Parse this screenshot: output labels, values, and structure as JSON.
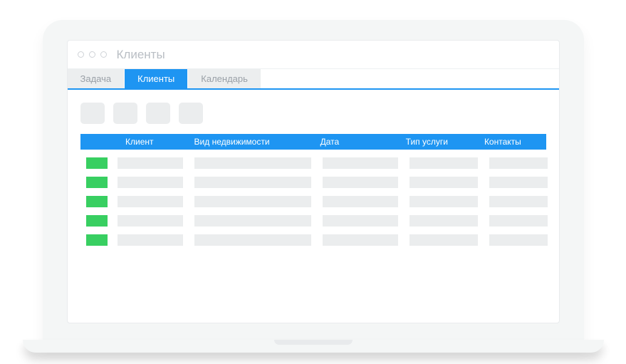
{
  "window": {
    "title": "Клиенты"
  },
  "tabs": [
    {
      "label": "Задача",
      "active": false
    },
    {
      "label": "Клиенты",
      "active": true
    },
    {
      "label": "Календарь",
      "active": false
    }
  ],
  "toolbar": {
    "button_count": 4
  },
  "table": {
    "columns": {
      "client": "Клиент",
      "type": "Вид недвижимости",
      "date": "Дата",
      "service": "Тип услуги",
      "contact": "Контакты"
    },
    "row_count": 5,
    "status_color": "#38cf61"
  },
  "colors": {
    "accent": "#1e95f2",
    "placeholder": "#ebedee",
    "chrome": "#f4f6f6"
  }
}
